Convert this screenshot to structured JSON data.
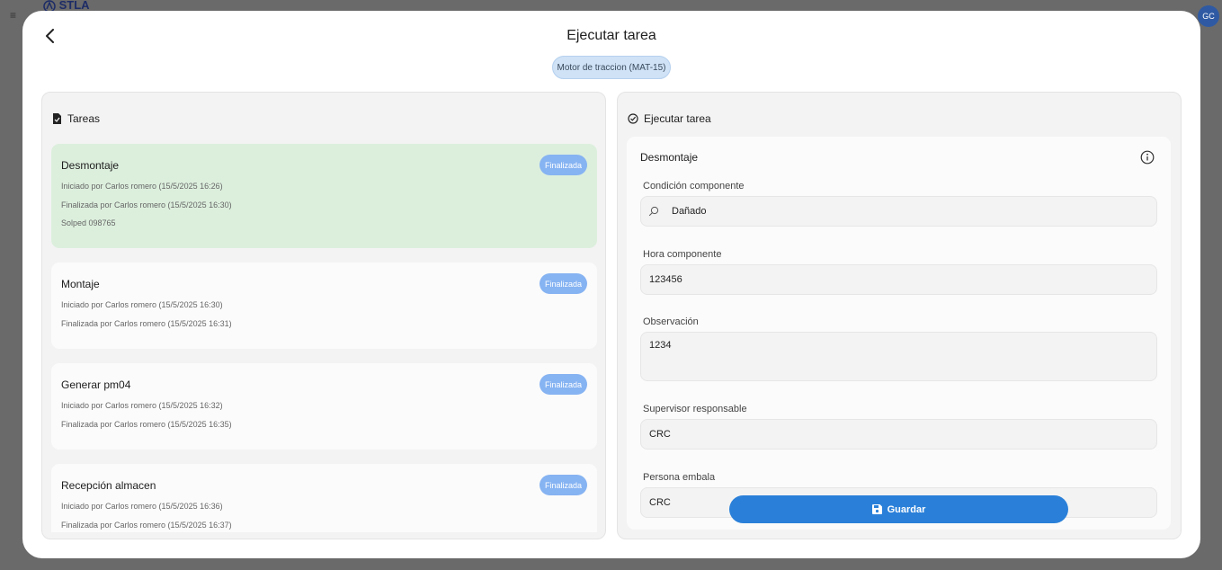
{
  "background": {
    "logo_text": "STLA",
    "avatar_initials": "GC"
  },
  "modal": {
    "title": "Ejecutar tarea",
    "asset_chip": "Motor de traccion (MAT-15)"
  },
  "tasks_panel": {
    "title": "Tareas",
    "items": [
      {
        "name": "Desmontaje",
        "status": "Finalizada",
        "started": "Iniciado por Carlos romero (15/5/2025 16:26)",
        "finished": "Finalizada por Carlos romero (15/5/2025 16:30)",
        "extra": "Solped 098765"
      },
      {
        "name": "Montaje",
        "status": "Finalizada",
        "started": "Iniciado por Carlos romero (15/5/2025 16:30)",
        "finished": "Finalizada por Carlos romero (15/5/2025 16:31)"
      },
      {
        "name": "Generar pm04",
        "status": "Finalizada",
        "started": "Iniciado por Carlos romero (15/5/2025 16:32)",
        "finished": "Finalizada por Carlos romero (15/5/2025 16:35)"
      },
      {
        "name": "Recepción almacen",
        "status": "Finalizada",
        "started": "Iniciado por Carlos romero (15/5/2025 16:36)",
        "finished": "Finalizada por Carlos romero (15/5/2025 16:37)"
      }
    ]
  },
  "execute_panel": {
    "title": "Ejecutar tarea",
    "task_name": "Desmontaje",
    "fields": {
      "condition_label": "Condición componente",
      "condition_value": "Dañado",
      "hours_label": "Hora componente",
      "hours_value": "123456",
      "observation_label": "Observación",
      "observation_value": "1234",
      "supervisor_label": "Supervisor responsable",
      "supervisor_value": "CRC",
      "packer_label": "Persona embala",
      "packer_value": "CRC"
    }
  },
  "actions": {
    "save_label": "Guardar"
  },
  "colors": {
    "primary": "#2a80d9",
    "badge": "#86b3f2",
    "active_task": "#dcefdd",
    "chip": "#cfe2f6"
  }
}
